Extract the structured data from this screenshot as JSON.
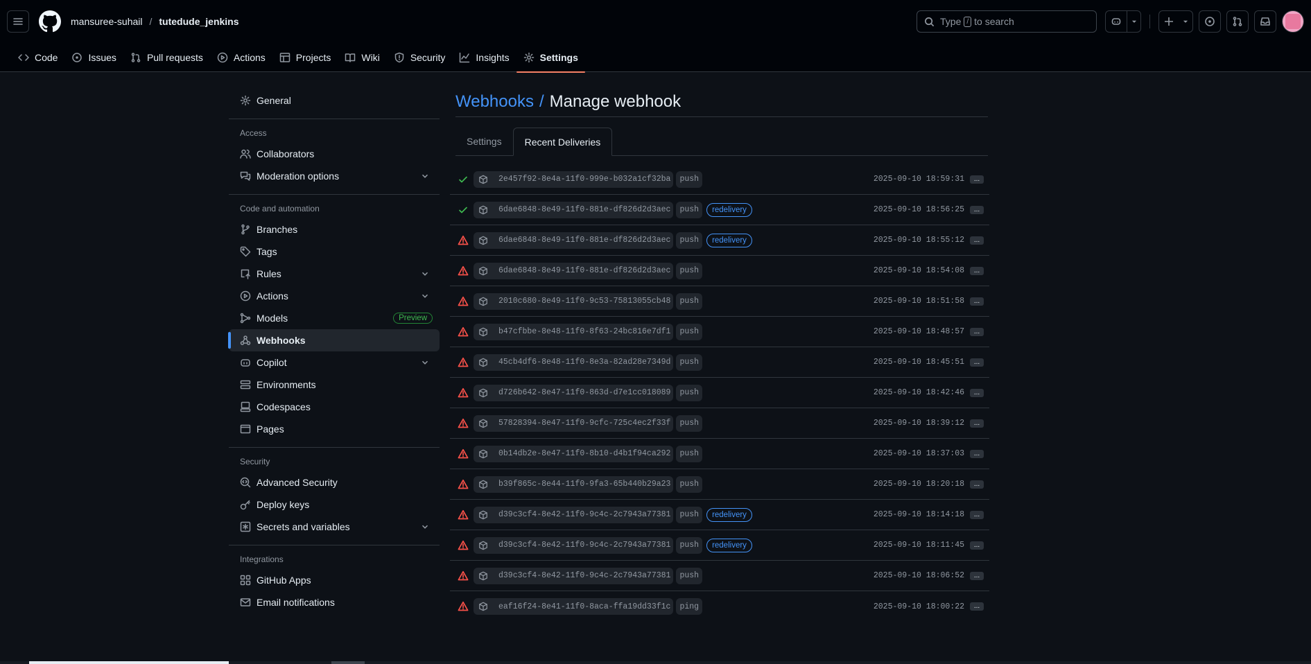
{
  "header": {
    "owner": "mansuree-suhail",
    "separator": "/",
    "repo": "tutedude_jenkins",
    "search": {
      "prefix": "Type",
      "key": "/",
      "suffix": "to search"
    }
  },
  "repo_tabs": [
    {
      "label": "Code",
      "icon": "code-icon"
    },
    {
      "label": "Issues",
      "icon": "issue-icon"
    },
    {
      "label": "Pull requests",
      "icon": "pull-request-icon"
    },
    {
      "label": "Actions",
      "icon": "play-icon"
    },
    {
      "label": "Projects",
      "icon": "table-icon"
    },
    {
      "label": "Wiki",
      "icon": "book-icon"
    },
    {
      "label": "Security",
      "icon": "shield-icon"
    },
    {
      "label": "Insights",
      "icon": "graph-icon"
    },
    {
      "label": "Settings",
      "icon": "gear-icon",
      "active": true
    }
  ],
  "sidebar": {
    "general": "General",
    "access_heading": "Access",
    "access": [
      "Collaborators",
      "Moderation options"
    ],
    "code_heading": "Code and automation",
    "code": [
      "Branches",
      "Tags",
      "Rules",
      "Actions",
      "Models",
      "Webhooks",
      "Copilot",
      "Environments",
      "Codespaces",
      "Pages"
    ],
    "models_badge": "Preview",
    "security_heading": "Security",
    "security": [
      "Advanced Security",
      "Deploy keys",
      "Secrets and variables"
    ],
    "integrations_heading": "Integrations",
    "integrations": [
      "GitHub Apps",
      "Email notifications"
    ]
  },
  "page": {
    "breadcrumb_link": "Webhooks",
    "breadcrumb_sep": "/",
    "title": "Manage webhook",
    "tabs": [
      "Settings",
      "Recent Deliveries"
    ],
    "active_tab": "Recent Deliveries",
    "more_label": "..."
  },
  "deliveries": [
    {
      "status": "success",
      "guid": "2e457f92-8e4a-11f0-999e-b032a1cf32ba",
      "event": "push",
      "redelivery": "",
      "time": "2025-09-10 18:59:31"
    },
    {
      "status": "success",
      "guid": "6dae6848-8e49-11f0-881e-df826d2d3aec",
      "event": "push",
      "redelivery": "redelivery",
      "time": "2025-09-10 18:56:25"
    },
    {
      "status": "failure",
      "guid": "6dae6848-8e49-11f0-881e-df826d2d3aec",
      "event": "push",
      "redelivery": "redelivery",
      "time": "2025-09-10 18:55:12"
    },
    {
      "status": "failure",
      "guid": "6dae6848-8e49-11f0-881e-df826d2d3aec",
      "event": "push",
      "redelivery": "",
      "time": "2025-09-10 18:54:08"
    },
    {
      "status": "failure",
      "guid": "2010c680-8e49-11f0-9c53-75813055cb48",
      "event": "push",
      "redelivery": "",
      "time": "2025-09-10 18:51:58"
    },
    {
      "status": "failure",
      "guid": "b47cfbbe-8e48-11f0-8f63-24bc816e7df1",
      "event": "push",
      "redelivery": "",
      "time": "2025-09-10 18:48:57"
    },
    {
      "status": "failure",
      "guid": "45cb4df6-8e48-11f0-8e3a-82ad28e7349d",
      "event": "push",
      "redelivery": "",
      "time": "2025-09-10 18:45:51"
    },
    {
      "status": "failure",
      "guid": "d726b642-8e47-11f0-863d-d7e1cc018089",
      "event": "push",
      "redelivery": "",
      "time": "2025-09-10 18:42:46"
    },
    {
      "status": "failure",
      "guid": "57828394-8e47-11f0-9cfc-725c4ec2f33f",
      "event": "push",
      "redelivery": "",
      "time": "2025-09-10 18:39:12"
    },
    {
      "status": "failure",
      "guid": "0b14db2e-8e47-11f0-8b10-d4b1f94ca292",
      "event": "push",
      "redelivery": "",
      "time": "2025-09-10 18:37:03"
    },
    {
      "status": "failure",
      "guid": "b39f865c-8e44-11f0-9fa3-65b440b29a23",
      "event": "push",
      "redelivery": "",
      "time": "2025-09-10 18:20:18"
    },
    {
      "status": "failure",
      "guid": "d39c3cf4-8e42-11f0-9c4c-2c7943a77381",
      "event": "push",
      "redelivery": "redelivery",
      "time": "2025-09-10 18:14:18"
    },
    {
      "status": "failure",
      "guid": "d39c3cf4-8e42-11f0-9c4c-2c7943a77381",
      "event": "push",
      "redelivery": "redelivery",
      "time": "2025-09-10 18:11:45"
    },
    {
      "status": "failure",
      "guid": "d39c3cf4-8e42-11f0-9c4c-2c7943a77381",
      "event": "push",
      "redelivery": "",
      "time": "2025-09-10 18:06:52"
    },
    {
      "status": "failure",
      "guid": "eaf16f24-8e41-11f0-8aca-ffa19dd33f1c",
      "event": "ping",
      "redelivery": "",
      "time": "2025-09-10 18:00:22"
    }
  ],
  "colors": {
    "accent": "#4493f8",
    "success": "#3fb950",
    "danger": "#f85149",
    "tab_underline": "#f78166"
  }
}
